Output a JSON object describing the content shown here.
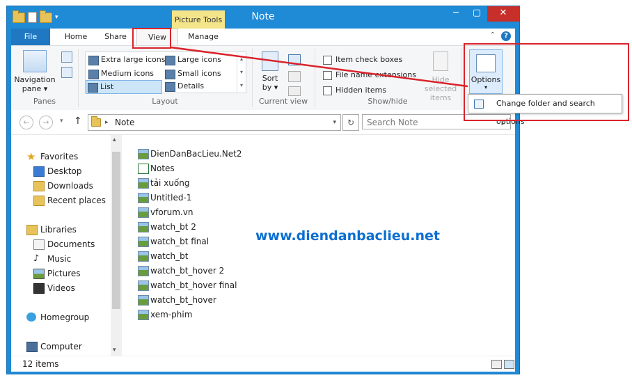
{
  "window": {
    "title": "Note",
    "context_tab": "Picture Tools"
  },
  "tabs": {
    "file": "File",
    "home": "Home",
    "share": "Share",
    "view": "View",
    "manage": "Manage"
  },
  "ribbon": {
    "panes": {
      "nav_line1": "Navigation",
      "nav_line2": "pane",
      "label": "Panes"
    },
    "layout": {
      "items": [
        "Extra large icons",
        "Large icons",
        "Medium icons",
        "Small icons",
        "List",
        "Details"
      ],
      "selected": "List",
      "label": "Layout"
    },
    "current_view": {
      "sort_line1": "Sort",
      "sort_line2": "by",
      "label": "Current view"
    },
    "show_hide": {
      "item_check_boxes": "Item check boxes",
      "file_name_extensions": "File name extensions",
      "hidden_items": "Hidden items",
      "hide_selected_line1": "Hide selected",
      "hide_selected_line2": "items",
      "label": "Show/hide"
    },
    "options": {
      "label": "Options"
    }
  },
  "dropdown": {
    "item": "Change folder and search options"
  },
  "address": {
    "path": "Note",
    "search_placeholder": "Search Note"
  },
  "nav": {
    "favorites": "Favorites",
    "desktop": "Desktop",
    "downloads": "Downloads",
    "recent": "Recent places",
    "libraries": "Libraries",
    "documents": "Documents",
    "music": "Music",
    "pictures": "Pictures",
    "videos": "Videos",
    "homegroup": "Homegroup",
    "computer": "Computer"
  },
  "files": [
    "DienDanBacLieu.Net2",
    "Notes",
    "tải xuống",
    "Untitled-1",
    "vforum.vn",
    "watch_bt 2",
    "watch_bt final",
    "watch_bt",
    "watch_bt_hover 2",
    "watch_bt_hover final",
    "watch_bt_hover",
    "xem-phim"
  ],
  "watermark": "www.diendanbaclieu.net",
  "status": {
    "count": "12 items"
  },
  "colors": {
    "accent": "#1f8ad6",
    "annotation": "#d9232b",
    "close": "#c7302a"
  }
}
